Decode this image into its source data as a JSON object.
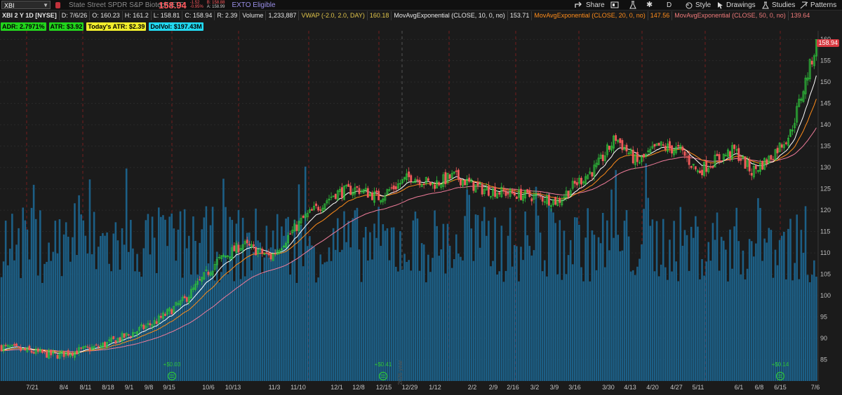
{
  "colors": {
    "up": "#2fc53b",
    "down": "#f05a5a",
    "volume": "#1c5f86",
    "ma10": "#ffffff",
    "ma20": "#ff8c1a",
    "ma50": "#ef7c9a"
  },
  "toolbar": {
    "symbol": "XBI",
    "description": "State Street SPDR S&P Biotech ETF",
    "last_price": "158.94",
    "change": "-1.52",
    "change_pct": "-0.95%",
    "bid": "B: 158.88",
    "ask": "A: 158.99",
    "exto": "EXTO Eligible",
    "share_label": "Share",
    "period": "D",
    "style_label": "Style",
    "drawings_label": "Drawings",
    "studies_label": "Studies",
    "patterns_label": "Patterns"
  },
  "header": {
    "title": "XBI 2 Y 1D [NYSE]",
    "date": "D: 7/6/26",
    "open": "O: 160.23",
    "high": "H: 161.2",
    "low": "L: 158.81",
    "close": "C: 158.94",
    "range": "R: 2.39",
    "volume_label": "Volume",
    "volume_value": "1,233,887",
    "vwap_label": "VWAP (-2.0, 2.0, DAY)",
    "vwap_value": "160.18",
    "ma10_label": "MovAvgExponential (CLOSE, 10, 0, no)",
    "ma10_value": "153.71",
    "ma20_label": "MovAvgExponential (CLOSE, 20, 0, no)",
    "ma20_value": "147.56",
    "ma50_label": "MovAvgExponential (CLOSE, 50, 0, no)",
    "ma50_value": "139.64"
  },
  "badges": [
    {
      "text": "ADR: 2.7971%",
      "color": "#22d41c"
    },
    {
      "text": "ATR: $3.92",
      "color": "#22d41c"
    },
    {
      "text": "Today's ATR: $2.39",
      "color": "#f2ee2c"
    },
    {
      "text": "DolVol: $197.43M",
      "color": "#22d8f0"
    }
  ],
  "chart_data": {
    "type": "candlestick",
    "y_ticks": [
      85,
      90,
      95,
      100,
      105,
      110,
      115,
      120,
      125,
      130,
      135,
      140,
      145,
      150,
      155,
      160
    ],
    "ylim": [
      80,
      162
    ],
    "current_price_tag": "158.94",
    "x_labels": [
      "7/21",
      "8/4",
      "8/11",
      "8/18",
      "9/1",
      "9/8",
      "9/15",
      "10/6",
      "10/13",
      "11/3",
      "11/10",
      "12/1",
      "12/8",
      "12/15",
      "12/29",
      "1/12",
      "2/2",
      "2/9",
      "2/16",
      "3/2",
      "3/9",
      "3/16",
      "3/30",
      "4/13",
      "4/20",
      "4/27",
      "5/11",
      "6/1",
      "6/8",
      "6/15",
      "7/6"
    ],
    "year_label": "2026 year",
    "dividends": [
      "+$0.03",
      "+$0.41",
      "+$0.14"
    ],
    "price_anchors": [
      [
        0,
        88
      ],
      [
        25,
        86
      ],
      [
        45,
        88
      ],
      [
        60,
        91
      ],
      [
        72,
        94
      ],
      [
        85,
        99
      ],
      [
        100,
        108
      ],
      [
        112,
        112
      ],
      [
        125,
        109
      ],
      [
        140,
        118
      ],
      [
        155,
        124
      ],
      [
        165,
        125
      ],
      [
        175,
        123
      ],
      [
        190,
        128
      ],
      [
        200,
        126
      ],
      [
        210,
        128
      ],
      [
        222,
        125
      ],
      [
        235,
        124
      ],
      [
        250,
        123
      ],
      [
        258,
        122
      ],
      [
        266,
        126
      ],
      [
        276,
        130
      ],
      [
        285,
        137
      ],
      [
        295,
        131
      ],
      [
        305,
        135
      ],
      [
        315,
        134
      ],
      [
        323,
        129
      ],
      [
        332,
        132
      ],
      [
        340,
        134
      ],
      [
        348,
        129
      ],
      [
        356,
        132
      ],
      [
        366,
        138
      ],
      [
        378,
        158.9
      ]
    ]
  }
}
